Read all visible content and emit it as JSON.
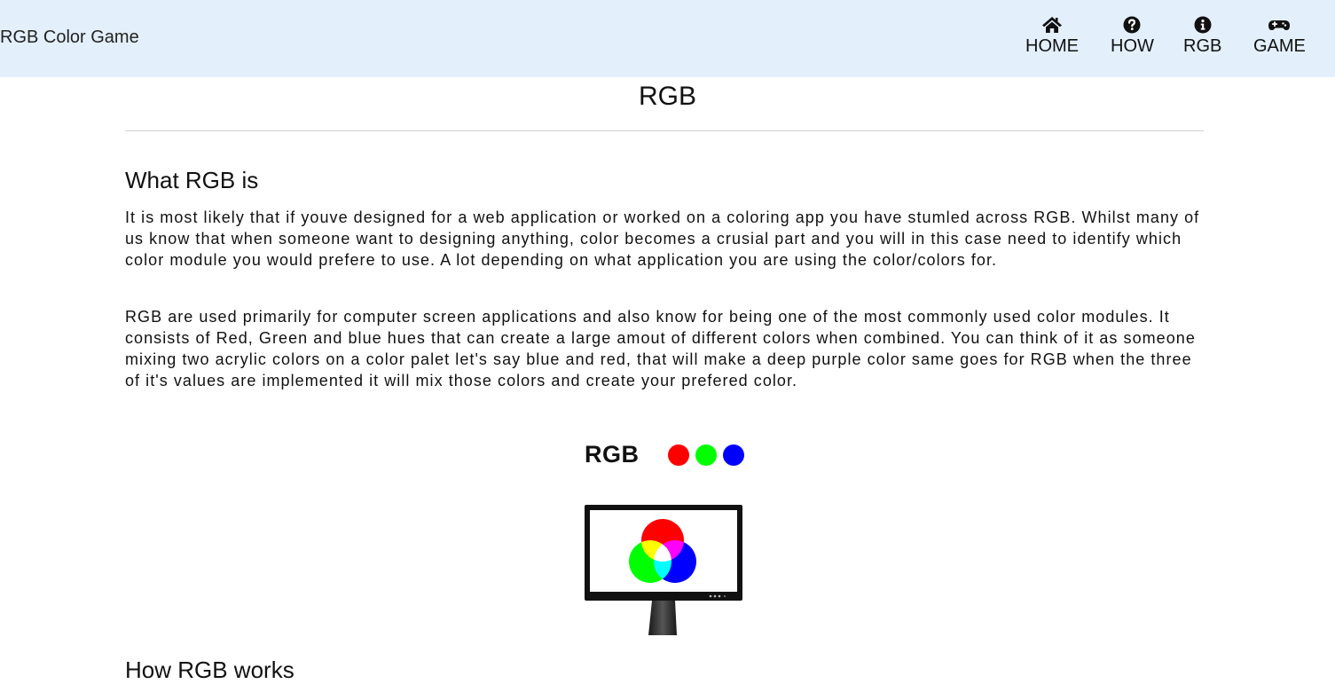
{
  "header": {
    "brand": "RGB Color Game",
    "nav": [
      {
        "label": "HOME",
        "icon": "home-icon"
      },
      {
        "label": "HOW",
        "icon": "question-circle-icon"
      },
      {
        "label": "RGB",
        "icon": "info-circle-icon"
      },
      {
        "label": "GAME",
        "icon": "gamepad-icon"
      }
    ],
    "background": "#e3f0fc"
  },
  "page": {
    "title": "RGB"
  },
  "sections": [
    {
      "heading": "What RGB is",
      "paragraphs": [
        "It is most likely that if youve designed for a web application or worked on a coloring app you have stumled across RGB. Whilst many of us know that when someone want to designing anything, color becomes a crusial part and you will in this case need to identify which color module you would prefere to use. A lot depending on what application you are using the color/colors for.",
        "RGB are used primarily for computer screen applications and also know for being one of the most commonly used color modules. It consists of Red, Green and blue hues that can create a large amout of different colors when combined. You can think of it as someone mixing two acrylic colors on a color palet let's say blue and red, that will make a deep purple color same goes for RGB when the three of it's values are implemented it will mix those colors and create your prefered color."
      ]
    },
    {
      "heading": "How RGB works"
    }
  ],
  "illustration": {
    "logo_text": "RGB",
    "colors": {
      "red": "#ff0000",
      "green": "#00ff00",
      "blue": "#0000ff"
    }
  }
}
